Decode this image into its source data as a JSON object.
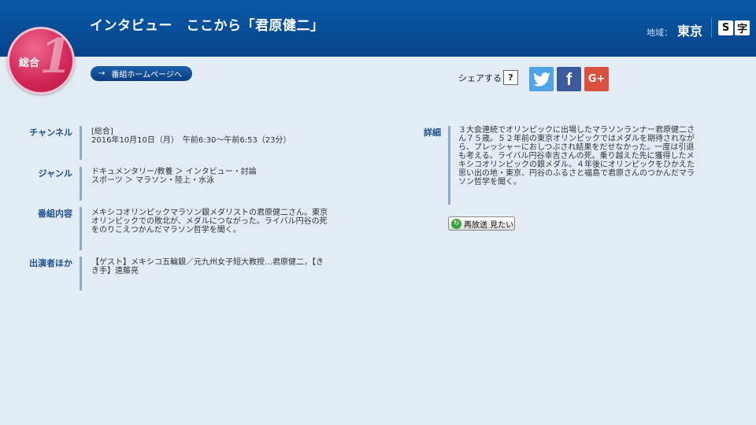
{
  "header": {
    "title": "インタビュー　ここから「君原健二」",
    "region_label": "地域：",
    "region_value": "東京",
    "subtitle_icon": [
      "S",
      "字"
    ]
  },
  "channel_badge": {
    "label": "総合",
    "number": "1",
    "color": "#d42a5c"
  },
  "home_button": {
    "arrow": "→",
    "label": "番組ホームページへ"
  },
  "share": {
    "label": "シェアする",
    "help": "?",
    "twitter_icon": "twitter-icon",
    "facebook_glyph": "f",
    "googleplus_glyph": "G+"
  },
  "info": {
    "channel": {
      "label": "チャンネル",
      "lines": [
        "[総合]",
        "2016年10月10日（月）　午前6:30～午前6:53（23分）"
      ]
    },
    "genre": {
      "label": "ジャンル",
      "lines": [
        "ドキュメンタリー/教養 ＞ インタビュー・討論",
        "スポーツ ＞ マラソン・陸上・水泳"
      ]
    },
    "content": {
      "label": "番組内容",
      "lines": [
        "メキシコオリンピックマラソン銀メダリストの君原健二さん。東京",
        "オリンピックでの敗北が、メダルにつながった。ライバル円谷の死",
        "をのりこえつかんだマラソン哲学を聞く。"
      ]
    },
    "cast": {
      "label": "出演者ほか",
      "lines": [
        "【ゲスト】メキシコ五輪銀／元九州女子短大教授…君原健二，【き",
        "き手】遠藤亮"
      ]
    }
  },
  "detail": {
    "label": "詳細",
    "lines": [
      "３大会連続でオリンピックに出場したマラソンランナー君原健二さ",
      "ん７５歳。５２年前の東京オリンピックではメダルを期待されなが",
      "ら、プレッシャーにおしつぶされ結果をだせなかった。一度は引退",
      "も考える。ライバル円谷幸吉さんの死。乗り越えた先に獲得したメ",
      "キシコオリンピックの銀メダル。４年後にオリンピックをひかえた",
      "思い出の地・東京、円谷のふるさと福島で君原さんのつかんだマラ",
      "ソン哲学を聞く。"
    ]
  },
  "rebroadcast_button": {
    "label": "再放送 見たい"
  },
  "colors": {
    "header": "#0a5aa8",
    "background": "#e3ebf4",
    "label": "#1b4f8f",
    "twitter": "#4fa3e6",
    "facebook": "#3a5a9c",
    "googleplus": "#d9503f"
  }
}
